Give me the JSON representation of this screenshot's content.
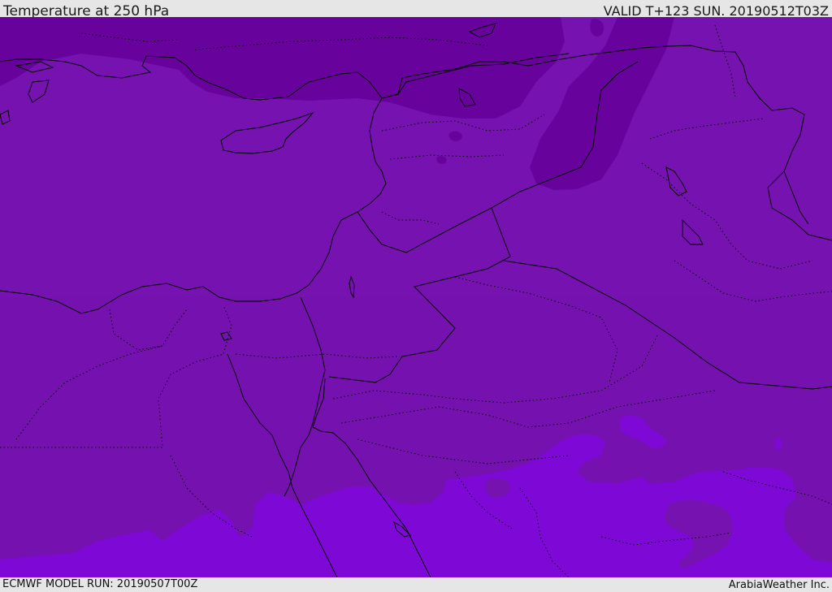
{
  "header": {
    "title": "Temperature at 250 hPa",
    "valid": "VALID T+123 SUN. 20190512T03Z"
  },
  "footer": {
    "model_run": "ECMWF MODEL RUN: 20190507T00Z",
    "credit": "ArabiaWeather Inc."
  },
  "colors": {
    "field_base": "#7612b0",
    "field_cold": "#68029c",
    "field_warm_south": "#7e08d6",
    "land_mid": "#7a10b6",
    "border": "#000000",
    "frame": "#e6e6e6"
  }
}
